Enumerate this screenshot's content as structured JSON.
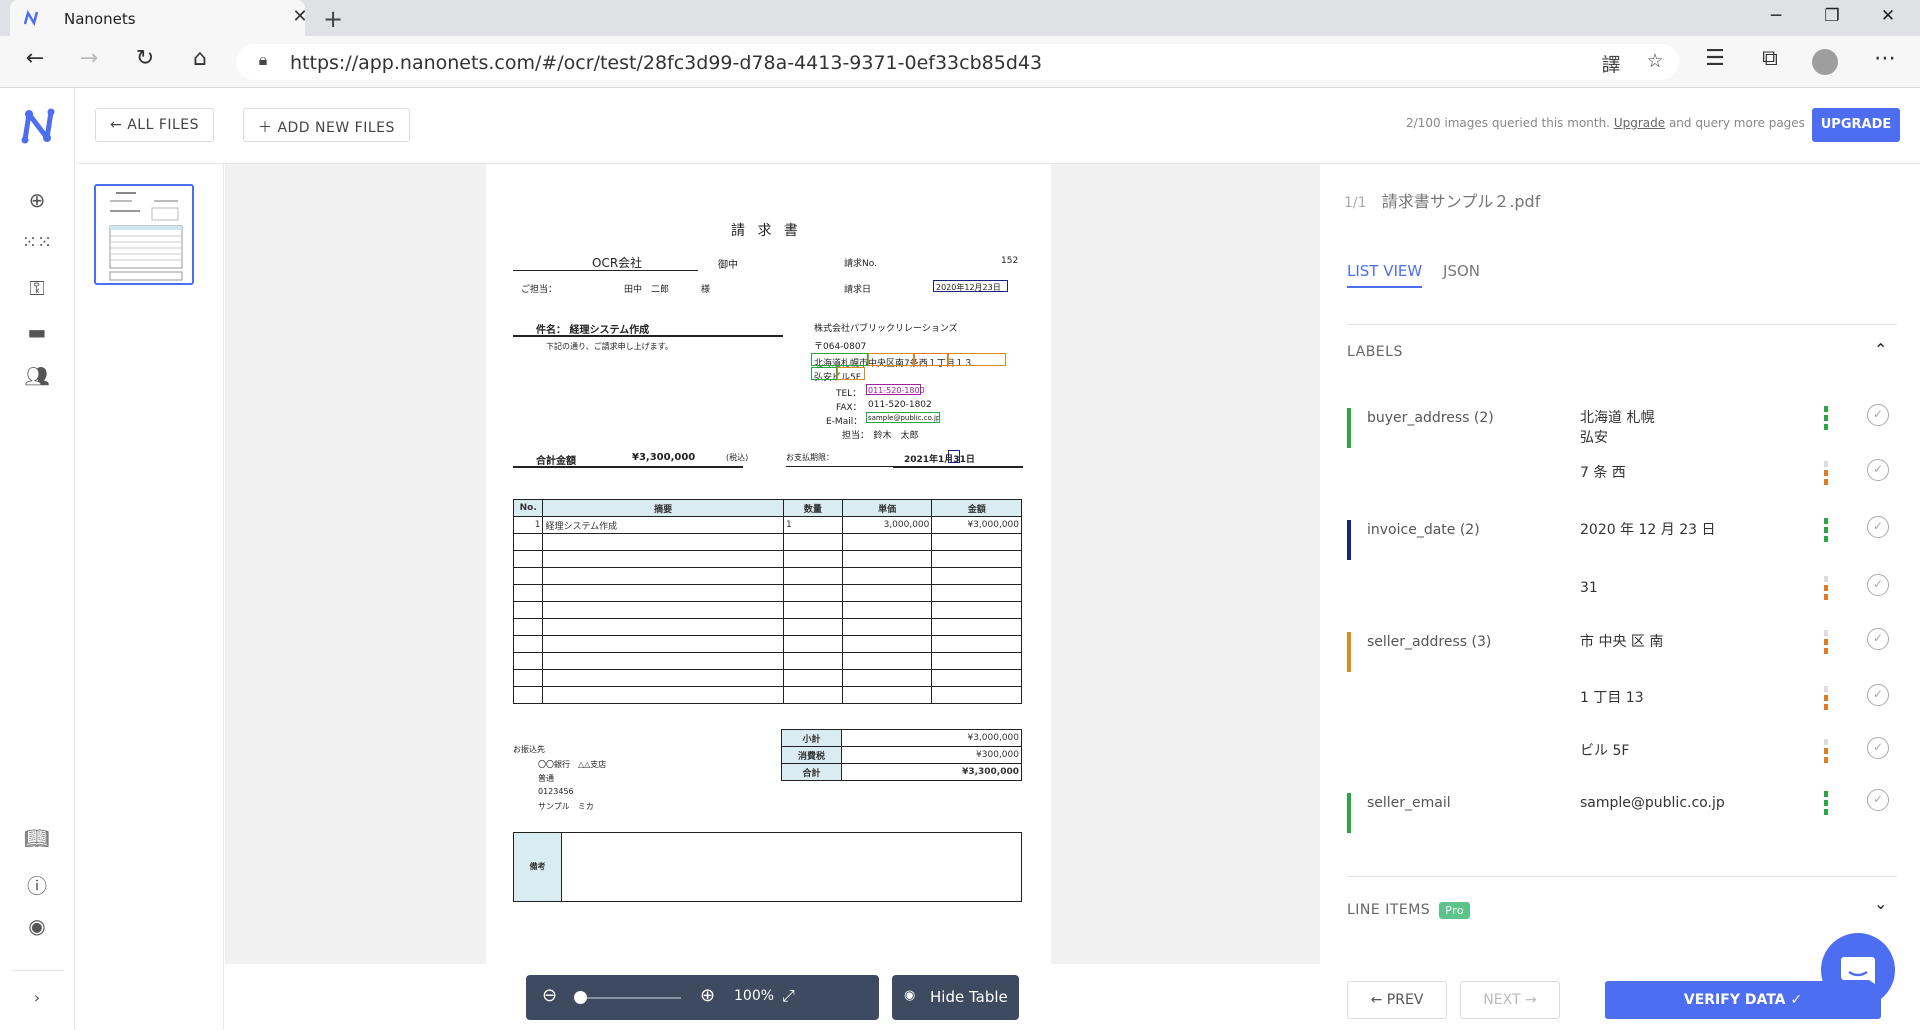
{
  "browser": {
    "tab_title": "Nanonets",
    "url": "https://app.nanonets.com/#/ocr/test/28fc3d99-d78a-4413-9371-0ef33cb85d43"
  },
  "toolbar": {
    "all_files": "ALL FILES",
    "add_new_files": "ADD NEW FILES",
    "quota_prefix": "2/100 images queried this month. ",
    "quota_link": "Upgrade",
    "quota_suffix": " and query more pages",
    "upgrade": "UPGRADE"
  },
  "viewer": {
    "zoom": "100%",
    "hide_table": "Hide Table"
  },
  "document": {
    "title": "請 求 書",
    "company": "OCR会社",
    "onchu": "御中",
    "invoice_no_label": "請求No.",
    "invoice_no": "152",
    "contact_label": "ご担当：",
    "contact_name": "田中　二郎",
    "contact_sama": "様",
    "invoice_date_label": "請求日",
    "invoice_date": "2020年12月23日",
    "subject": "件名：  経理システム作成",
    "subject_note": "下記の通り、ご請求申し上げます。",
    "seller_name": "株式会社パブリックリレーションズ",
    "seller_zip": "〒064-0807",
    "seller_addr1": "北海道札幌市中央区南7条西１丁目１３",
    "seller_addr2": "弘安ビル5F",
    "tel": "TEL：",
    "tel_val": "011-520-1800",
    "fax": "FAX：",
    "fax_val": "011-520-1802",
    "email": "E-Mail：",
    "email_val": "sample@public.co.jp",
    "staff": "担当：　鈴木　太郎",
    "total_label": "合計金額",
    "total": "¥3,300,000",
    "tax_incl": "(税込)",
    "due_label": "お支払期限：",
    "due_date": "2021年1月31日",
    "table_headers": [
      "No.",
      "摘要",
      "数量",
      "単価",
      "金額"
    ],
    "row1": [
      "1",
      "経理システム作成",
      "1",
      "3,000,000",
      "¥3,000,000"
    ],
    "subtotal_label": "小計",
    "subtotal": "¥3,000,000",
    "tax_label": "消費税",
    "tax": "¥300,000",
    "grand_label": "合計",
    "grand": "¥3,300,000",
    "bank_label": "お振込先",
    "bank1": "〇〇銀行　△△支店",
    "bank2": "普通",
    "bank3": "0123456",
    "bank4": "サンプル　ミカ",
    "remarks": "備考"
  },
  "panel": {
    "page_counter": "1/1",
    "file_name": "請求書サンプル２.pdf",
    "tab_list": "LIST VIEW",
    "tab_json": "JSON",
    "labels_header": "LABELS",
    "labels": [
      {
        "name": "buyer_address (2)",
        "value": "北海道 札幌\n弘安",
        "color": "#27a745"
      },
      {
        "name": "",
        "value": "7 条 西",
        "color": ""
      },
      {
        "name": "invoice_date (2)",
        "value": "2020 年 12 月 23 日",
        "color": "#1a237e"
      },
      {
        "name": "",
        "value": "31",
        "color": ""
      },
      {
        "name": "seller_address (3)",
        "value": "市 中央 区 南",
        "color": "#d98b1c"
      },
      {
        "name": "",
        "value": "1 丁目 13",
        "color": ""
      },
      {
        "name": "",
        "value": "ビル 5F",
        "color": ""
      },
      {
        "name": "seller_email",
        "value": "sample@public.co.jp",
        "color": "#27a745"
      }
    ],
    "line_items": "LINE ITEMS",
    "pro": "Pro",
    "prev": "PREV",
    "next": "NEXT",
    "verify": "VERIFY DATA"
  },
  "colors": {
    "accent": "#4e6ef2",
    "green": "#27a745",
    "orange": "#e07b22"
  }
}
